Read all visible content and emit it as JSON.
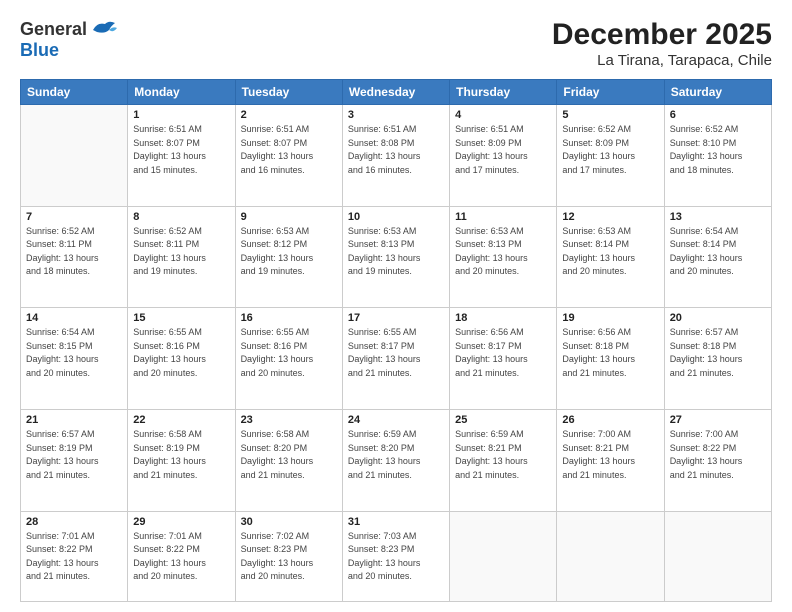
{
  "header": {
    "logo_general": "General",
    "logo_blue": "Blue",
    "title": "December 2025",
    "subtitle": "La Tirana, Tarapaca, Chile"
  },
  "days_of_week": [
    "Sunday",
    "Monday",
    "Tuesday",
    "Wednesday",
    "Thursday",
    "Friday",
    "Saturday"
  ],
  "weeks": [
    [
      {
        "day": "",
        "info": ""
      },
      {
        "day": "1",
        "info": "Sunrise: 6:51 AM\nSunset: 8:07 PM\nDaylight: 13 hours\nand 15 minutes."
      },
      {
        "day": "2",
        "info": "Sunrise: 6:51 AM\nSunset: 8:07 PM\nDaylight: 13 hours\nand 16 minutes."
      },
      {
        "day": "3",
        "info": "Sunrise: 6:51 AM\nSunset: 8:08 PM\nDaylight: 13 hours\nand 16 minutes."
      },
      {
        "day": "4",
        "info": "Sunrise: 6:51 AM\nSunset: 8:09 PM\nDaylight: 13 hours\nand 17 minutes."
      },
      {
        "day": "5",
        "info": "Sunrise: 6:52 AM\nSunset: 8:09 PM\nDaylight: 13 hours\nand 17 minutes."
      },
      {
        "day": "6",
        "info": "Sunrise: 6:52 AM\nSunset: 8:10 PM\nDaylight: 13 hours\nand 18 minutes."
      }
    ],
    [
      {
        "day": "7",
        "info": "Sunrise: 6:52 AM\nSunset: 8:11 PM\nDaylight: 13 hours\nand 18 minutes."
      },
      {
        "day": "8",
        "info": "Sunrise: 6:52 AM\nSunset: 8:11 PM\nDaylight: 13 hours\nand 19 minutes."
      },
      {
        "day": "9",
        "info": "Sunrise: 6:53 AM\nSunset: 8:12 PM\nDaylight: 13 hours\nand 19 minutes."
      },
      {
        "day": "10",
        "info": "Sunrise: 6:53 AM\nSunset: 8:13 PM\nDaylight: 13 hours\nand 19 minutes."
      },
      {
        "day": "11",
        "info": "Sunrise: 6:53 AM\nSunset: 8:13 PM\nDaylight: 13 hours\nand 20 minutes."
      },
      {
        "day": "12",
        "info": "Sunrise: 6:53 AM\nSunset: 8:14 PM\nDaylight: 13 hours\nand 20 minutes."
      },
      {
        "day": "13",
        "info": "Sunrise: 6:54 AM\nSunset: 8:14 PM\nDaylight: 13 hours\nand 20 minutes."
      }
    ],
    [
      {
        "day": "14",
        "info": "Sunrise: 6:54 AM\nSunset: 8:15 PM\nDaylight: 13 hours\nand 20 minutes."
      },
      {
        "day": "15",
        "info": "Sunrise: 6:55 AM\nSunset: 8:16 PM\nDaylight: 13 hours\nand 20 minutes."
      },
      {
        "day": "16",
        "info": "Sunrise: 6:55 AM\nSunset: 8:16 PM\nDaylight: 13 hours\nand 20 minutes."
      },
      {
        "day": "17",
        "info": "Sunrise: 6:55 AM\nSunset: 8:17 PM\nDaylight: 13 hours\nand 21 minutes."
      },
      {
        "day": "18",
        "info": "Sunrise: 6:56 AM\nSunset: 8:17 PM\nDaylight: 13 hours\nand 21 minutes."
      },
      {
        "day": "19",
        "info": "Sunrise: 6:56 AM\nSunset: 8:18 PM\nDaylight: 13 hours\nand 21 minutes."
      },
      {
        "day": "20",
        "info": "Sunrise: 6:57 AM\nSunset: 8:18 PM\nDaylight: 13 hours\nand 21 minutes."
      }
    ],
    [
      {
        "day": "21",
        "info": "Sunrise: 6:57 AM\nSunset: 8:19 PM\nDaylight: 13 hours\nand 21 minutes."
      },
      {
        "day": "22",
        "info": "Sunrise: 6:58 AM\nSunset: 8:19 PM\nDaylight: 13 hours\nand 21 minutes."
      },
      {
        "day": "23",
        "info": "Sunrise: 6:58 AM\nSunset: 8:20 PM\nDaylight: 13 hours\nand 21 minutes."
      },
      {
        "day": "24",
        "info": "Sunrise: 6:59 AM\nSunset: 8:20 PM\nDaylight: 13 hours\nand 21 minutes."
      },
      {
        "day": "25",
        "info": "Sunrise: 6:59 AM\nSunset: 8:21 PM\nDaylight: 13 hours\nand 21 minutes."
      },
      {
        "day": "26",
        "info": "Sunrise: 7:00 AM\nSunset: 8:21 PM\nDaylight: 13 hours\nand 21 minutes."
      },
      {
        "day": "27",
        "info": "Sunrise: 7:00 AM\nSunset: 8:22 PM\nDaylight: 13 hours\nand 21 minutes."
      }
    ],
    [
      {
        "day": "28",
        "info": "Sunrise: 7:01 AM\nSunset: 8:22 PM\nDaylight: 13 hours\nand 21 minutes."
      },
      {
        "day": "29",
        "info": "Sunrise: 7:01 AM\nSunset: 8:22 PM\nDaylight: 13 hours\nand 20 minutes."
      },
      {
        "day": "30",
        "info": "Sunrise: 7:02 AM\nSunset: 8:23 PM\nDaylight: 13 hours\nand 20 minutes."
      },
      {
        "day": "31",
        "info": "Sunrise: 7:03 AM\nSunset: 8:23 PM\nDaylight: 13 hours\nand 20 minutes."
      },
      {
        "day": "",
        "info": ""
      },
      {
        "day": "",
        "info": ""
      },
      {
        "day": "",
        "info": ""
      }
    ]
  ]
}
